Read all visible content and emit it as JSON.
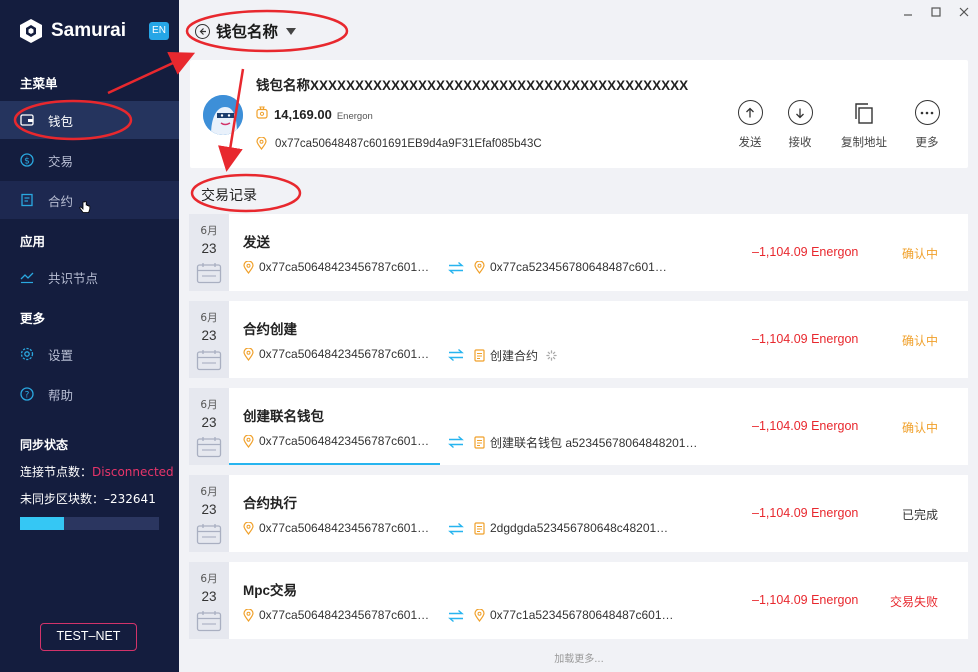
{
  "app": {
    "name": "Samurai",
    "lang": "EN"
  },
  "sidebar": {
    "sections": [
      {
        "title": "主菜单"
      },
      {
        "title": "应用"
      },
      {
        "title": "更多"
      }
    ],
    "items": [
      {
        "label": "钱包",
        "icon": "wallet-icon",
        "active": true
      },
      {
        "label": "交易",
        "icon": "dollar-icon"
      },
      {
        "label": "合约",
        "icon": "contract-icon"
      },
      {
        "label": "共识节点",
        "icon": "node-icon"
      },
      {
        "label": "设置",
        "icon": "gear-icon"
      },
      {
        "label": "帮助",
        "icon": "help-icon"
      }
    ],
    "sync": {
      "title": "同步状态",
      "node_label": "连接节点数：",
      "node_value": "Disconnected",
      "block_label": "未同步区块数：",
      "block_value": "–232641",
      "progress": 0.32
    },
    "network": "TEST–NET"
  },
  "header": {
    "title": "钱包名称"
  },
  "wallet": {
    "name": "钱包名称XXXXXXXXXXXXXXXXXXXXXXXXXXXXXXXXXXXXXXXXXX",
    "balance": "14,169.00",
    "unit": "Energon",
    "address": "0x77ca50648487c601691EB9d4a9F31Efaf085b43C",
    "actions": [
      {
        "label": "发送",
        "icon": "send-icon"
      },
      {
        "label": "接收",
        "icon": "receive-icon"
      },
      {
        "label": "复制地址",
        "icon": "copy-icon"
      },
      {
        "label": "更多",
        "icon": "more-icon"
      }
    ]
  },
  "transactions_label": "交易记录",
  "transactions": [
    {
      "month": "6月",
      "day": "23",
      "title": "发送",
      "from": "0x77ca50648423456787c601…",
      "to": "0x77ca523456780648487c601…",
      "to_icon": "location-pin-icon",
      "amount": "–1,104.09 Energon",
      "status": "确认中",
      "status_type": "pending"
    },
    {
      "month": "6月",
      "day": "23",
      "title": "合约创建",
      "from": "0x77ca50648423456787c601…",
      "to": "创建合约",
      "to_icon": "contract-doc-icon",
      "amount": "–1,104.09 Energon",
      "status": "确认中",
      "status_type": "pending",
      "spinner": true
    },
    {
      "month": "6月",
      "day": "23",
      "title": "创建联名钱包",
      "from": "0x77ca50648423456787c601…",
      "to": "创建联名钱包 a52345678064848201…",
      "to_icon": "contract-doc-icon",
      "amount": "–1,104.09 Energon",
      "status": "确认中",
      "status_type": "pending",
      "progress": 0.5
    },
    {
      "month": "6月",
      "day": "23",
      "title": "合约执行",
      "from": "0x77ca50648423456787c601…",
      "to": "2dgdgda523456780648c48201…",
      "to_icon": "contract-doc-icon",
      "amount": "–1,104.09 Energon",
      "status": "已完成",
      "status_type": "done"
    },
    {
      "month": "6月",
      "day": "23",
      "title": "Mpc交易",
      "from": "0x77ca50648423456787c601…",
      "to": "0x77c1a523456780648487c601…",
      "to_icon": "location-pin-icon",
      "amount": "–1,104.09 Energon",
      "status": "交易失败",
      "status_type": "fail"
    }
  ],
  "load_more": "加载更多...",
  "colors": {
    "sidebar_bg": "#141d3e",
    "accent": "#27b4ef",
    "pending": "#f0a02a",
    "negative": "#e8282e",
    "annotation": "#e8282e"
  }
}
